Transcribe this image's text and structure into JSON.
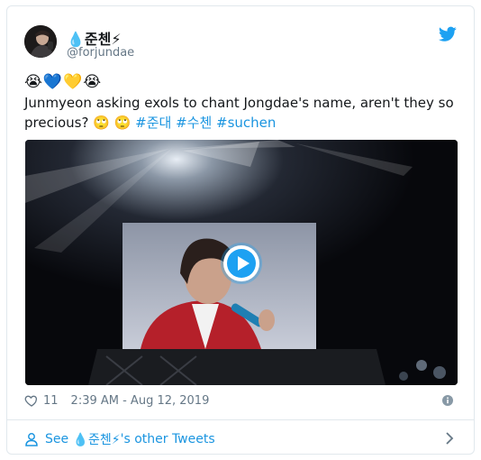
{
  "author": {
    "display_name": "💧준첸⚡",
    "handle": "@forjundae"
  },
  "tweet": {
    "emoji_line": "😭💙💛😭",
    "text_main": "Junmyeon asking exols to chant Jongdae's name, aren't they so precious? 🙄 🙄 ",
    "hashtags": [
      "#준대",
      "#수첸",
      "#suchen"
    ]
  },
  "stats": {
    "likes": "11",
    "timestamp": "2:39 AM - Aug 12, 2019"
  },
  "footer": {
    "see_prefix": "See ",
    "see_name": "💧준첸⚡",
    "see_suffix": "'s other Tweets"
  },
  "icons": {
    "brand": "twitter-bird-icon",
    "like": "heart-icon",
    "info": "info-icon",
    "profile": "person-icon",
    "next": "chevron-right-icon",
    "video": "play-icon"
  },
  "colors": {
    "link": "#1b95e0",
    "brand": "#1da1f2",
    "muted": "#657786",
    "text": "#14171a"
  }
}
